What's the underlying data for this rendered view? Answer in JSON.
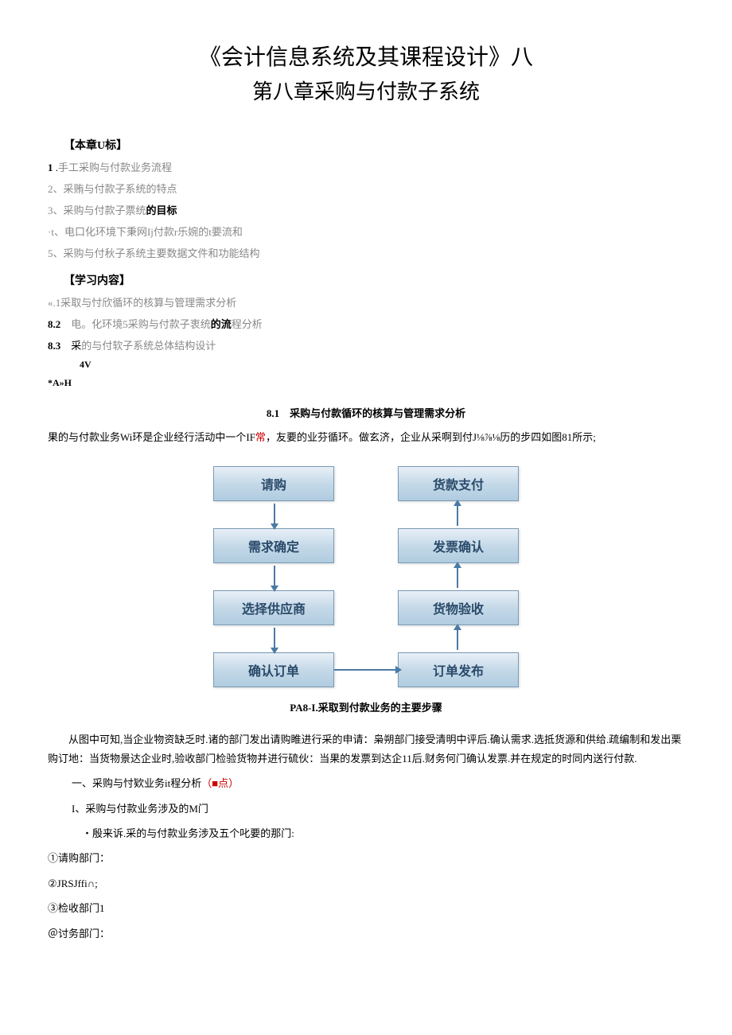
{
  "title_main": "《会计信息系统及其课程设计》八",
  "title_sub": "第八章采购与付款子系统",
  "objectives_header": "【本章U标】",
  "objectives": [
    {
      "num": "1",
      "sep": " .",
      "text": "手工采购与付款业务流程"
    },
    {
      "num": "2、",
      "sep": "",
      "text": "采贿与付款子系统的特点"
    },
    {
      "num": "3、",
      "sep": "",
      "text": "采购与付款子票统",
      "tail": "的目标"
    },
    {
      "num": "·t、",
      "sep": "",
      "text": "电口化环境下秉网Ij付款r乐婉的t要流和"
    },
    {
      "num": "5、",
      "sep": "",
      "text": "采购与付秋子系统主要数据文件和功能结构"
    }
  ],
  "contents_header": "【学习内容】",
  "contents": [
    {
      "num": "«.1",
      "text": "采取与忖欣循环的核算与管理需求分析"
    },
    {
      "num": "8.2",
      "pre": "电。化环境5采购与付款子衷统",
      "mid": "的流",
      "post": "程分析"
    },
    {
      "num": "8.3",
      "pre": "采",
      "gray": "的与付软子系统总体结构设计"
    }
  ],
  "extra_lines": [
    "4V",
    "*A»H"
  ],
  "section_81": "8.1　采购与付款循环的核算与管理需求分析",
  "para_1a": "果的与付款业务Wi环是企业经行活动中一个IF",
  "para_1_red": "常",
  "para_1b": "，友要的业芬循环。做玄济，企业从采啊到付J⅛⅞⅛历的步四如图81所示;",
  "diagram": {
    "left": [
      "请购",
      "需求确定",
      "选择供应商",
      "确认订单"
    ],
    "right": [
      "货款支付",
      "发票确认",
      "货物验收",
      "订单发布"
    ]
  },
  "diagram_caption": "PA8-I.采取到付款业务的主要步骤",
  "para_2": "　　从图中可知,当企业物资缺乏时.诸的部门发出请购睢进行采的申请：枭朔部门接受清明中评后.确认需求.选抵货源和供给.疏编制和发出栗购订地：当货物景达企业时,验收部门检验货物并进行硫伙：当果的发票到达企11后.财务何门确认发票.并在规定的时同内送行付款.",
  "sub_a_pre": "一、采购与忖欵业务it程分析",
  "sub_a_red": "（■点）",
  "sub_b": "I、采购与付款业务涉及的M门",
  "sub_c": "　・殷来诉.采的与付款业务涉及五个叱要的那门:",
  "depts": [
    "①请购部门：",
    "②JRSJffi∩;",
    "③检收部门1",
    "＠讨务部门："
  ]
}
